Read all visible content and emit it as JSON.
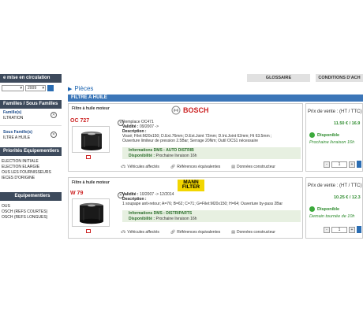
{
  "sidebar": {
    "circulation": {
      "title": "e mise en circulation",
      "month": "",
      "year": "2009"
    },
    "familles": {
      "title": "Familles / Sous Familles",
      "filter_label": "Famille(s)",
      "filter_value": "ILTRATION",
      "sub_label": "Sous Famille(s)",
      "sub_value": "ILTRE A HUILE"
    },
    "priorites": {
      "title": "Priorités Equipementiers",
      "items": [
        "ELECTION INITIALE",
        "ELECTION ELARGIE",
        "OUS LES FOURNISSEURS",
        "IECES D'ORIGINE"
      ]
    },
    "equipementiers": {
      "title": "Equipementiers",
      "items": [
        "OUS",
        "OSCH (REFS COURTES)",
        "OSCH (REFS LONGUES)"
      ]
    }
  },
  "top_buttons": {
    "glossaire": "GLOSSAIRE",
    "conditions": "CONDITIONS D'ACH"
  },
  "main": {
    "section_title": "Pièces",
    "category": "FILTRE A HUILE"
  },
  "products": [
    {
      "type": "Filtre à huile moteur",
      "brand": "BOSCH",
      "ref": "OC 727",
      "lines": [
        {
          "text": "Remplace OC471"
        },
        {
          "label": "Validité :",
          "text": " 09/2007 ->"
        },
        {
          "label": "Description :",
          "text": ""
        },
        {
          "text": "Vissé; Filet:M20x150; D.Ext.76mm; D.Ext.Joint 72mm; D.Int.Joint 62mm; Ht 63.5mm ;"
        },
        {
          "text": "Ouverture limiteur de pression 2.5Bar; Serrage 20Nm; Outil OCS1 nécessaire"
        }
      ],
      "dms_label": "Informations DMS :",
      "dms_value": "AUTO DISTRIB",
      "dispo_label": "Disponibilité :",
      "dispo_value": "Prochaine livraison 16h",
      "actions": [
        "Véhicules affectés",
        "Références équivalentes",
        "Données constructeur"
      ],
      "price_label": "Prix de vente : (HT / TTC)",
      "price": "11.50 € / 16.9",
      "status": "Disponible",
      "delay": "Prochaine livraison 16h",
      "qty": "1"
    },
    {
      "type": "Filtre à huile moteur",
      "brand_line1": "MANN",
      "brand_line2": "FILTER",
      "ref": "W 79",
      "lines": [
        {
          "label": "Validité :",
          "text": " 10/2007 -> 12/2014"
        },
        {
          "label": "Description :",
          "text": ""
        },
        {
          "text": "1 soupape anti-retour; A=76; B=62; C=71; G=Filet:M20x150; H=64; Ouverture by-pass 2Bar"
        }
      ],
      "dms_label": "Informations DMS :",
      "dms_value": "DISTRIPARTS",
      "dispo_label": "Disponibilité :",
      "dispo_value": "Prochaine livraison 16h",
      "actions": [
        "Véhicules affectés",
        "Références équivalentes",
        "Données constructeur"
      ],
      "price_label": "Prix de vente : (HT / TTC)",
      "price": "10.25 € / 12.3",
      "status": "Disponible",
      "delay": "Demain tournée de 10h",
      "qty": "1"
    }
  ],
  "colors": {
    "sidebar_header": "#3d4a5c",
    "category_bar": "#3b76b8",
    "reference": "#cc2222",
    "available": "#2b8a2b"
  }
}
